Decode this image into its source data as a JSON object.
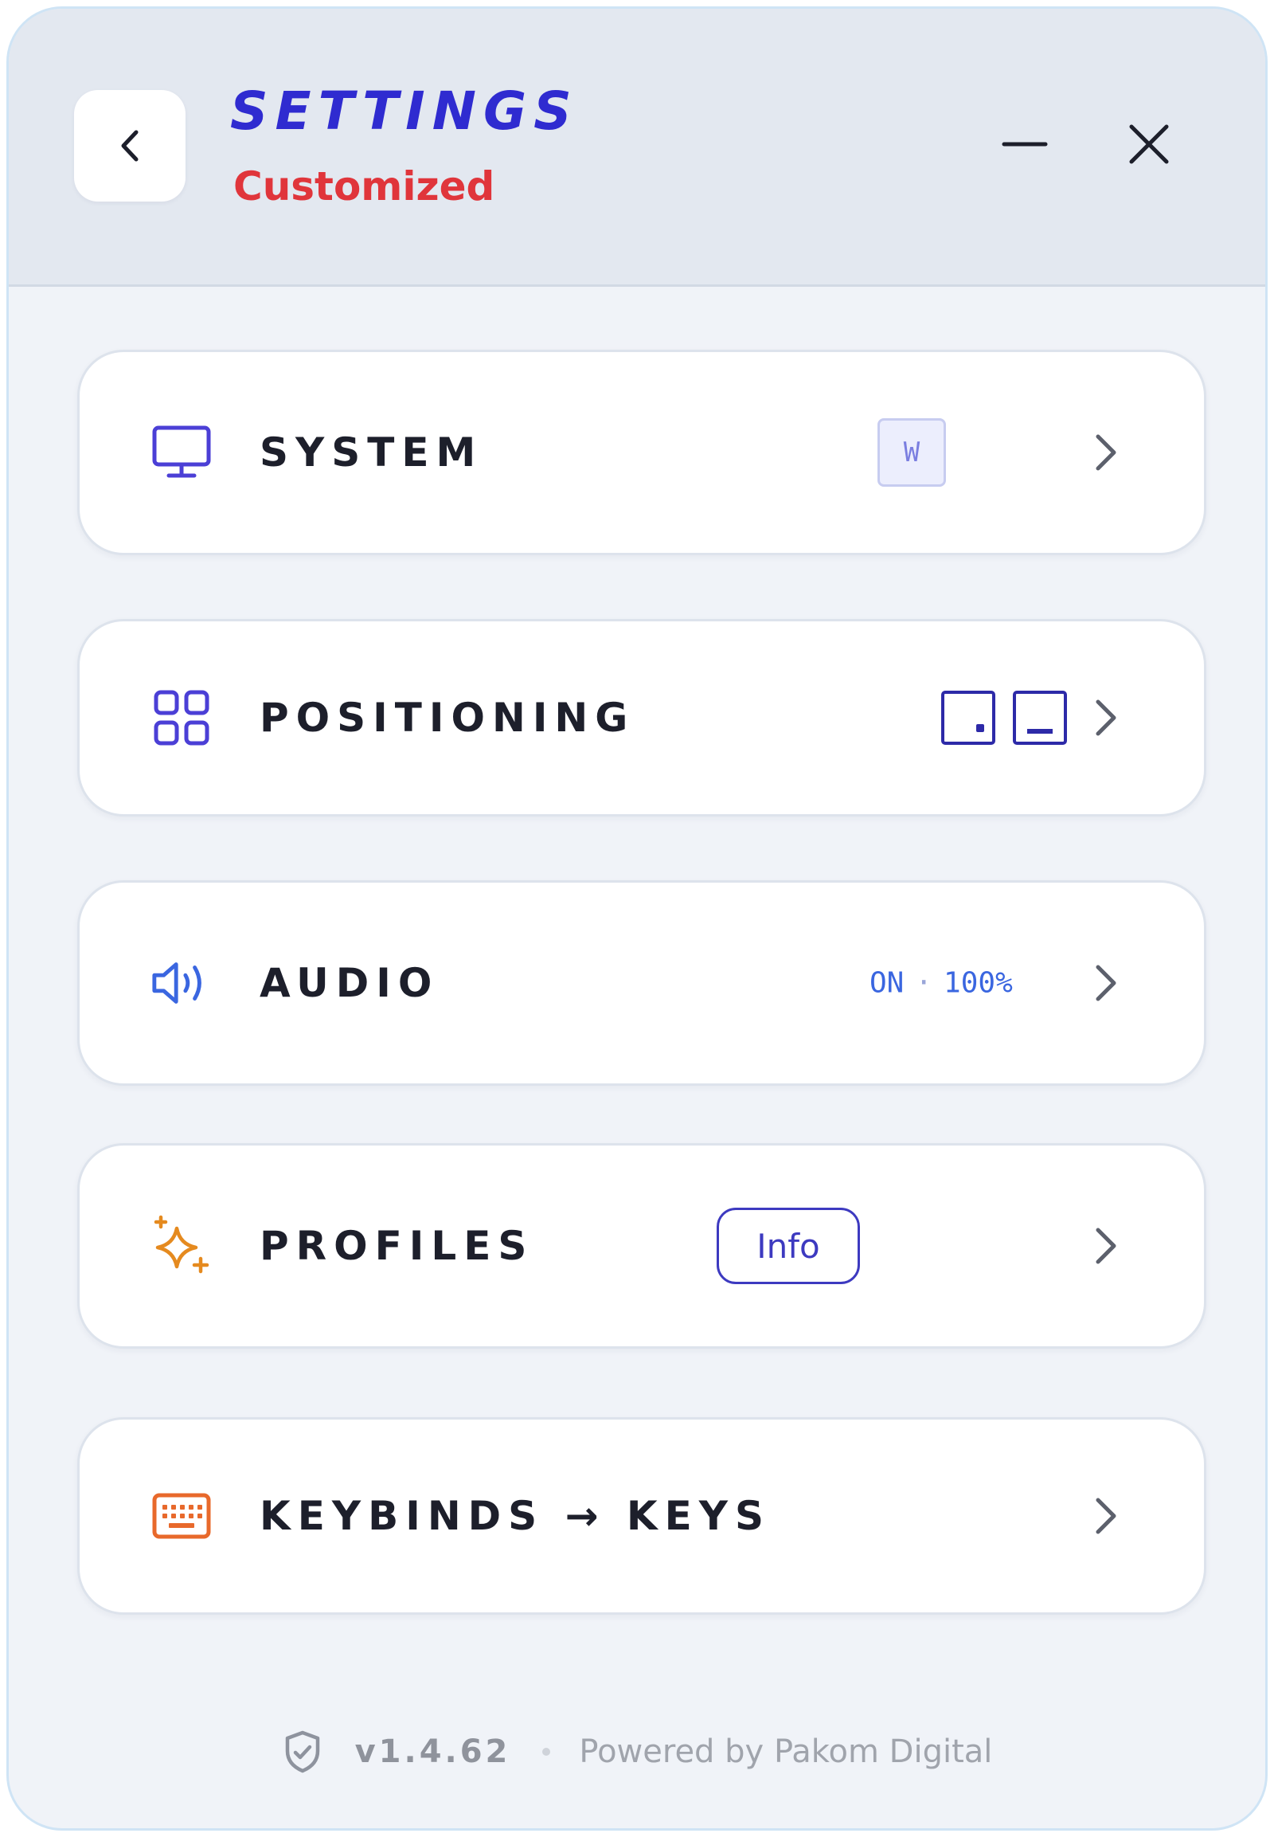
{
  "header": {
    "title": "SETTINGS",
    "subtitle": "Customized",
    "back_icon": "chevron-left-icon",
    "minimize_icon": "minimize-icon",
    "close_icon": "close-icon"
  },
  "menu": [
    {
      "label": "SYSTEM",
      "icon": "monitor-icon",
      "icon_color": "#4b3fd6",
      "badge": "W"
    },
    {
      "label": "POSITIONING",
      "icon": "grid-icon",
      "icon_color": "#4b3fd6",
      "position_options": [
        "position-dot-icon",
        "position-bar-icon"
      ]
    },
    {
      "label": "AUDIO",
      "icon": "speaker-icon",
      "icon_color": "#3a66e0",
      "status": "ON",
      "separator": "·",
      "volume": "100%"
    },
    {
      "label": "PROFILES",
      "icon": "sparkles-icon",
      "icon_color": "#e58a1f",
      "action_label": "Info"
    },
    {
      "label": "KEYBINDS → KEYS",
      "icon": "keyboard-icon",
      "icon_color": "#e8692b"
    }
  ],
  "footer": {
    "icon": "shield-check-icon",
    "version": "v1.4.62",
    "powered_by": "Powered by Pakom Digital"
  },
  "colors": {
    "accent": "#2f2bd0",
    "subtitle": "#e0353b",
    "audio": "#3a66e0"
  }
}
